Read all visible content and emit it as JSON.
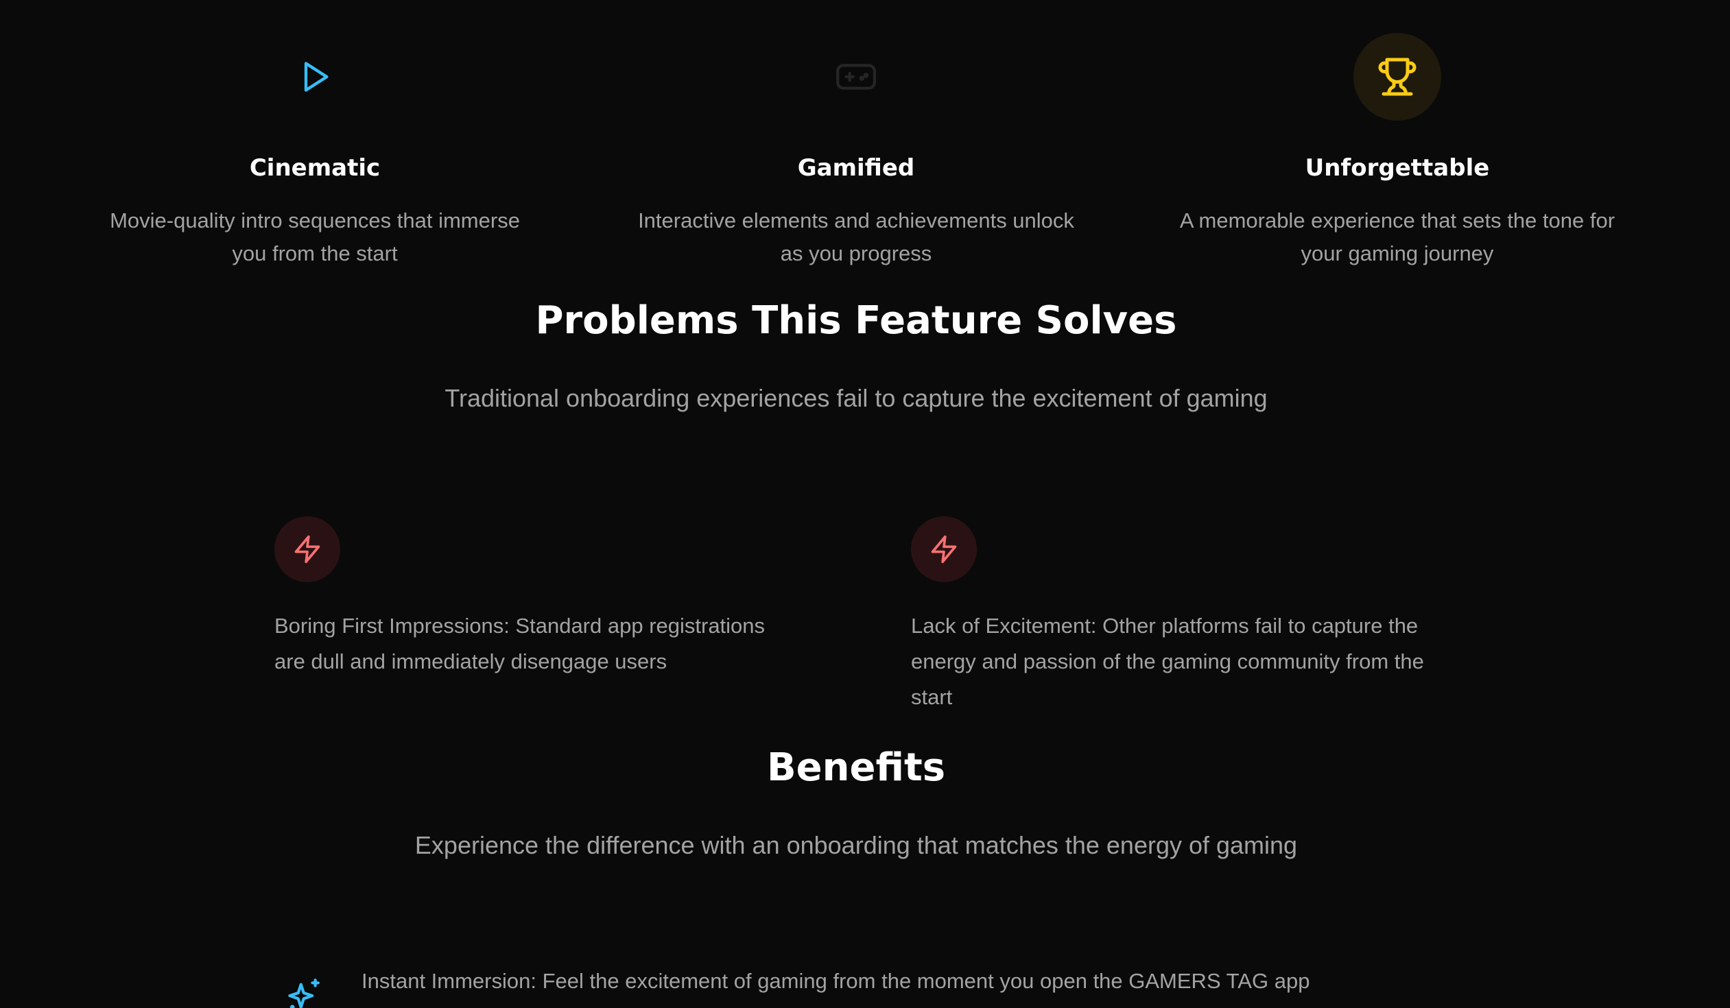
{
  "features": [
    {
      "icon": "play-icon",
      "icon_color": "#38bdf8",
      "title": "Cinematic",
      "description": "Movie-quality intro sequences that immerse you from the start"
    },
    {
      "icon": "gamepad-icon",
      "icon_color": "#262626",
      "title": "Gamified",
      "description": "Interactive elements and achievements unlock as you progress"
    },
    {
      "icon": "trophy-icon",
      "icon_color": "#facc15",
      "icon_bg": "#1f1a0c",
      "title": "Unforgettable",
      "description": "A memorable experience that sets the tone for your gaming journey"
    }
  ],
  "problems": {
    "heading": "Problems This Feature Solves",
    "subheading": "Traditional onboarding experiences fail to capture the excitement of gaming",
    "items": [
      {
        "icon": "lightning-icon",
        "icon_color": "#f87171",
        "text": "Boring First Impressions: Standard app registrations are dull and immediately disengage users"
      },
      {
        "icon": "lightning-icon",
        "icon_color": "#f87171",
        "text": "Lack of Excitement: Other platforms fail to capture the energy and passion of the gaming community from the start"
      }
    ]
  },
  "benefits": {
    "heading": "Benefits",
    "subheading": "Experience the difference with an onboarding that matches the energy of gaming",
    "items": [
      {
        "icon": "sparkles-icon",
        "icon_color": "#38bdf8",
        "text": "Instant Immersion: Feel the excitement of gaming from the moment you open the GAMERS TAG app"
      }
    ]
  },
  "colors": {
    "background": "#0a0a0a",
    "heading": "#ffffff",
    "body_text": "#a3a3a3",
    "accent_blue": "#38bdf8",
    "accent_red": "#f87171",
    "accent_gold": "#facc15"
  }
}
